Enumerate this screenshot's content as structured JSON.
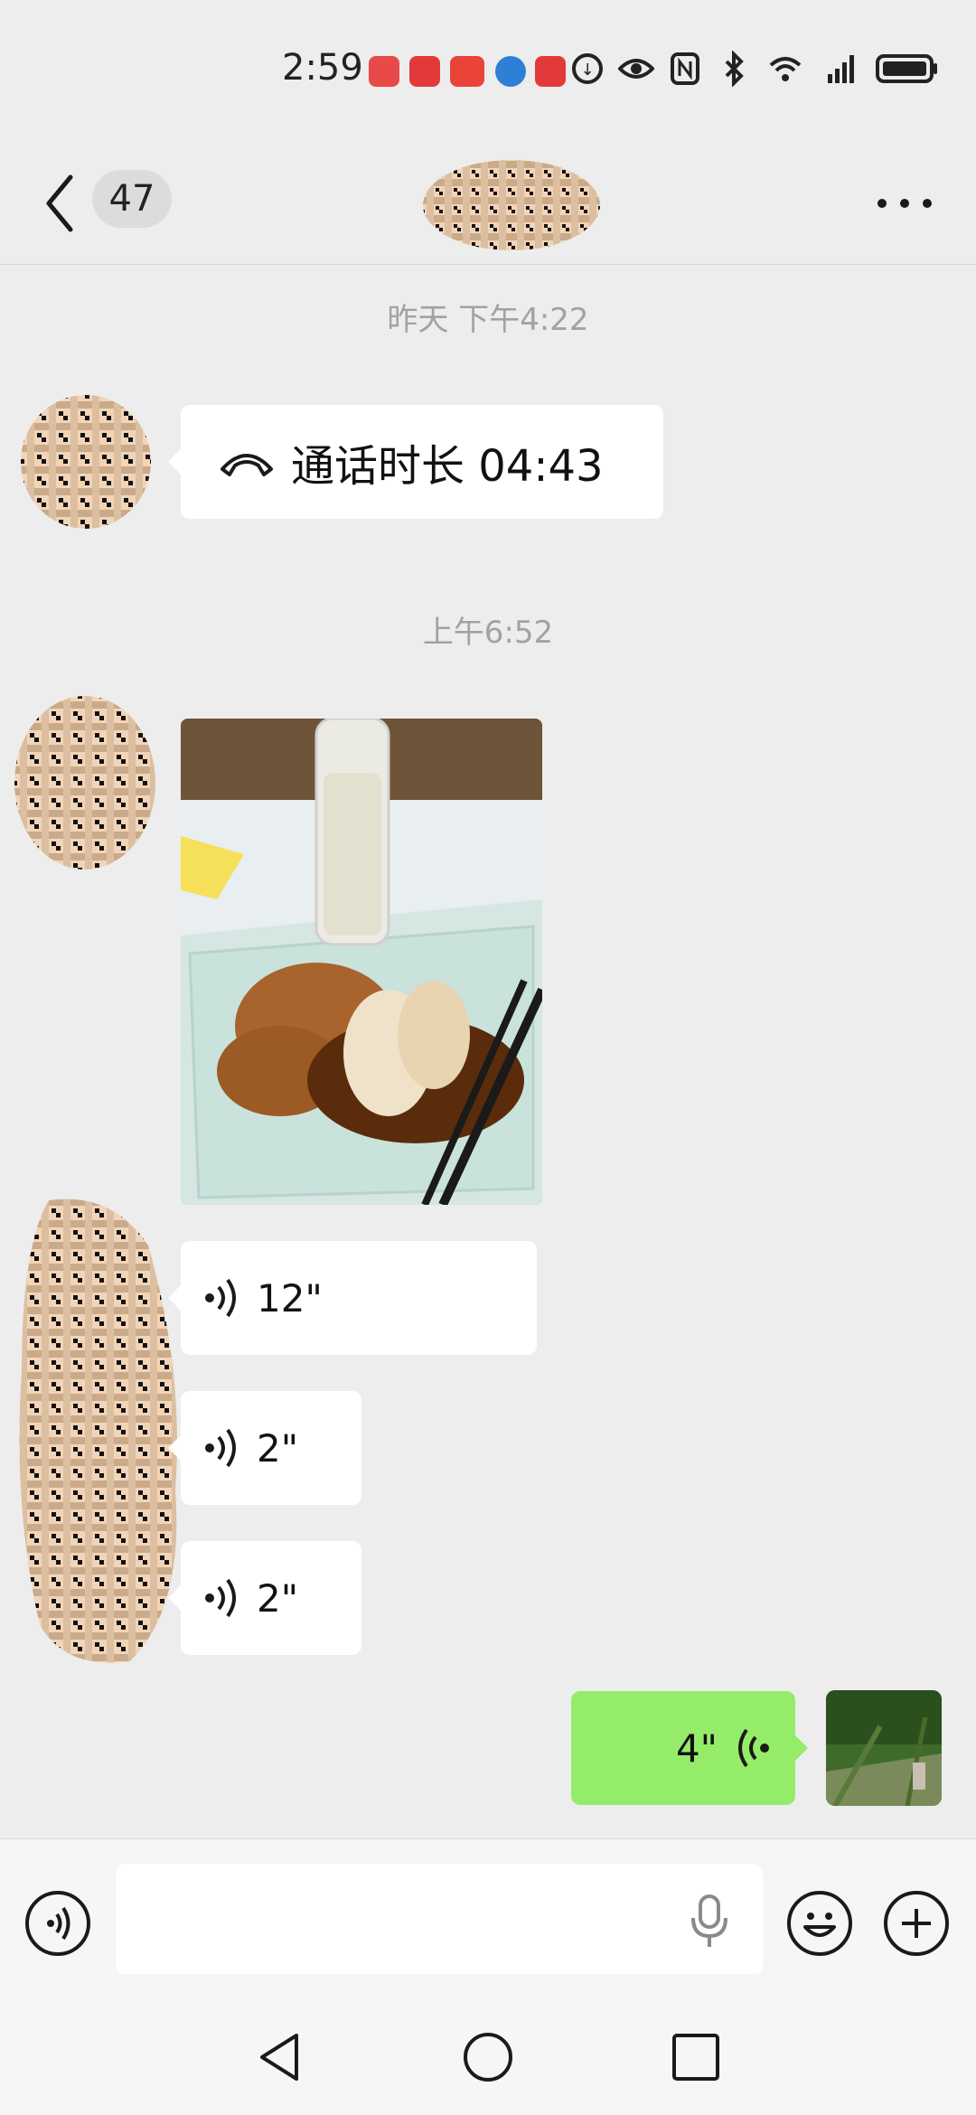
{
  "status_bar": {
    "time": "2:59",
    "app_badges": [
      {
        "name": "huawei-app-icon",
        "color": "#e84a4a"
      },
      {
        "name": "app-icon-red",
        "color": "#e23a3a"
      },
      {
        "name": "toutiao-app-icon",
        "color": "#e9433a"
      },
      {
        "name": "browser-app-icon",
        "color": "#2e7fd6"
      },
      {
        "name": "app-icon-red-2",
        "color": "#e23a3a"
      }
    ],
    "icons": [
      "data-saver-icon",
      "eye-comfort-icon",
      "nfc-icon",
      "bluetooth-icon",
      "wifi-icon",
      "5g-signal-icon",
      "battery-icon"
    ]
  },
  "header": {
    "unread_count": "47",
    "title_obscured": true
  },
  "messages": {
    "timestamp_1": "昨天 下午4:22",
    "call": {
      "label": "通话时长 04:43"
    },
    "timestamp_2": "上午6:52",
    "voice_in": [
      {
        "duration": "12\""
      },
      {
        "duration": "2\""
      },
      {
        "duration": "2\""
      }
    ],
    "voice_out": {
      "duration": "4\""
    }
  },
  "input_bar": {
    "placeholder": "",
    "value": ""
  },
  "colors": {
    "background": "#ededed",
    "outgoing_bubble": "#95ec69",
    "incoming_bubble": "#ffffff",
    "timestamp_text": "#a2a2a2"
  }
}
